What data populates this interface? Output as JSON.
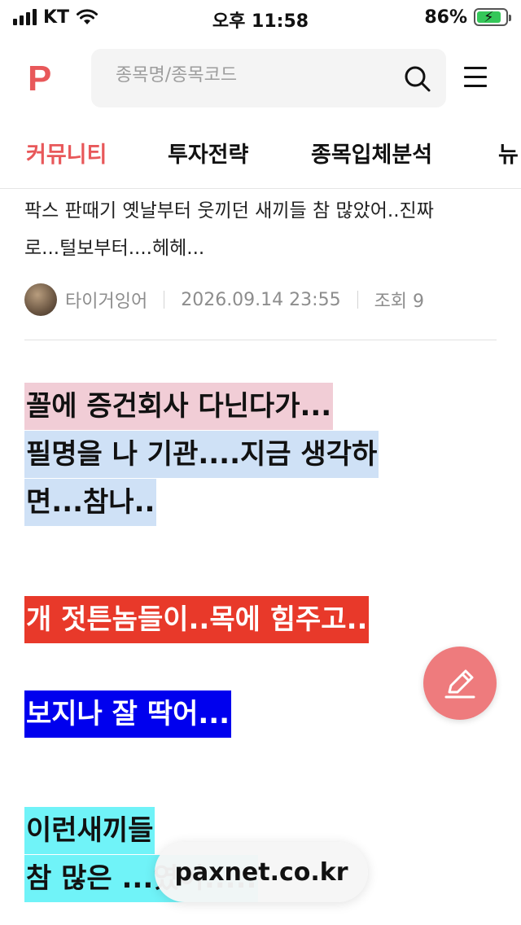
{
  "status_bar": {
    "carrier": "KT",
    "time": "오후 11:58",
    "battery_percent": "86%",
    "battery_level": 0.86,
    "icons": [
      "signal-icon",
      "wifi-icon",
      "battery-charging-icon"
    ]
  },
  "header": {
    "logo": "P",
    "search_placeholder": "종목명/종목코드",
    "icons": [
      "search-icon",
      "menu-icon"
    ]
  },
  "tabs": [
    {
      "label": "커뮤니티",
      "active": true
    },
    {
      "label": "투자전략",
      "active": false
    },
    {
      "label": "종목입체분석",
      "active": false
    },
    {
      "label": "뉴",
      "active": false
    }
  ],
  "post": {
    "preview_line_1": "팍스 판때기 옛날부터 웃끼던 새끼들 참 많았어..진짜",
    "preview_line_2": "로...털보부터....헤헤...",
    "author": "타이거잉어",
    "date": "2026.09.14 23:55",
    "views": "조회 9",
    "body_lines": [
      {
        "text": "꼴에 증건회사 다닌다가...",
        "bg": "#f1cdd6",
        "color": "#111111"
      },
      {
        "text": "필명을 나 기관....지금 생각하",
        "bg": "#cfe1f6",
        "color": "#111111"
      },
      {
        "text": "면...참나..",
        "bg": "#cfe1f6",
        "color": "#111111"
      },
      {
        "text": "개 젓튼놈들이..목에 힘주고..",
        "bg": "#e8392a",
        "color": "#ffffff"
      },
      {
        "text": "보지나 잘 딱어...",
        "bg": "#0000ee",
        "color": "#ffffff"
      },
      {
        "text": "이런새끼들",
        "bg": "#70f3f8",
        "color": "#111111"
      },
      {
        "text": "참 많은 ...였어.....",
        "bg": "#70f3f8",
        "color": "#111111"
      }
    ]
  },
  "floating": {
    "write_icon": "pencil-icon",
    "url": "paxnet.co.kr"
  },
  "colors": {
    "accent": "#e8585a",
    "write_button": "#ee7b7d"
  }
}
